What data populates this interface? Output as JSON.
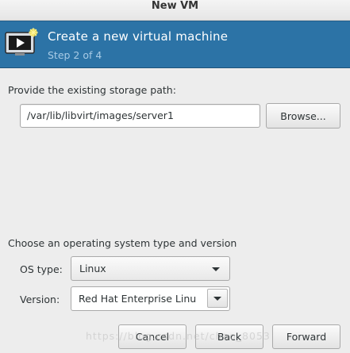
{
  "window": {
    "title": "New VM"
  },
  "banner": {
    "heading": "Create a new virtual machine",
    "step": "Step 2 of 4",
    "icon": "vm-monitor-icon",
    "background_color": "#2c73a6"
  },
  "storage": {
    "label": "Provide the existing storage path:",
    "path_value": "/var/lib/libvirt/images/server1",
    "browse_label": "Browse..."
  },
  "os": {
    "section_label": "Choose an operating system type and version",
    "type_label": "OS type:",
    "type_value": "Linux",
    "version_label": "Version:",
    "version_value": "Red Hat Enterprise Linu"
  },
  "buttons": {
    "cancel": "Cancel",
    "back": "Back",
    "forward": "Forward"
  },
  "watermark": "https://blog.csdn.net/chao_8053"
}
